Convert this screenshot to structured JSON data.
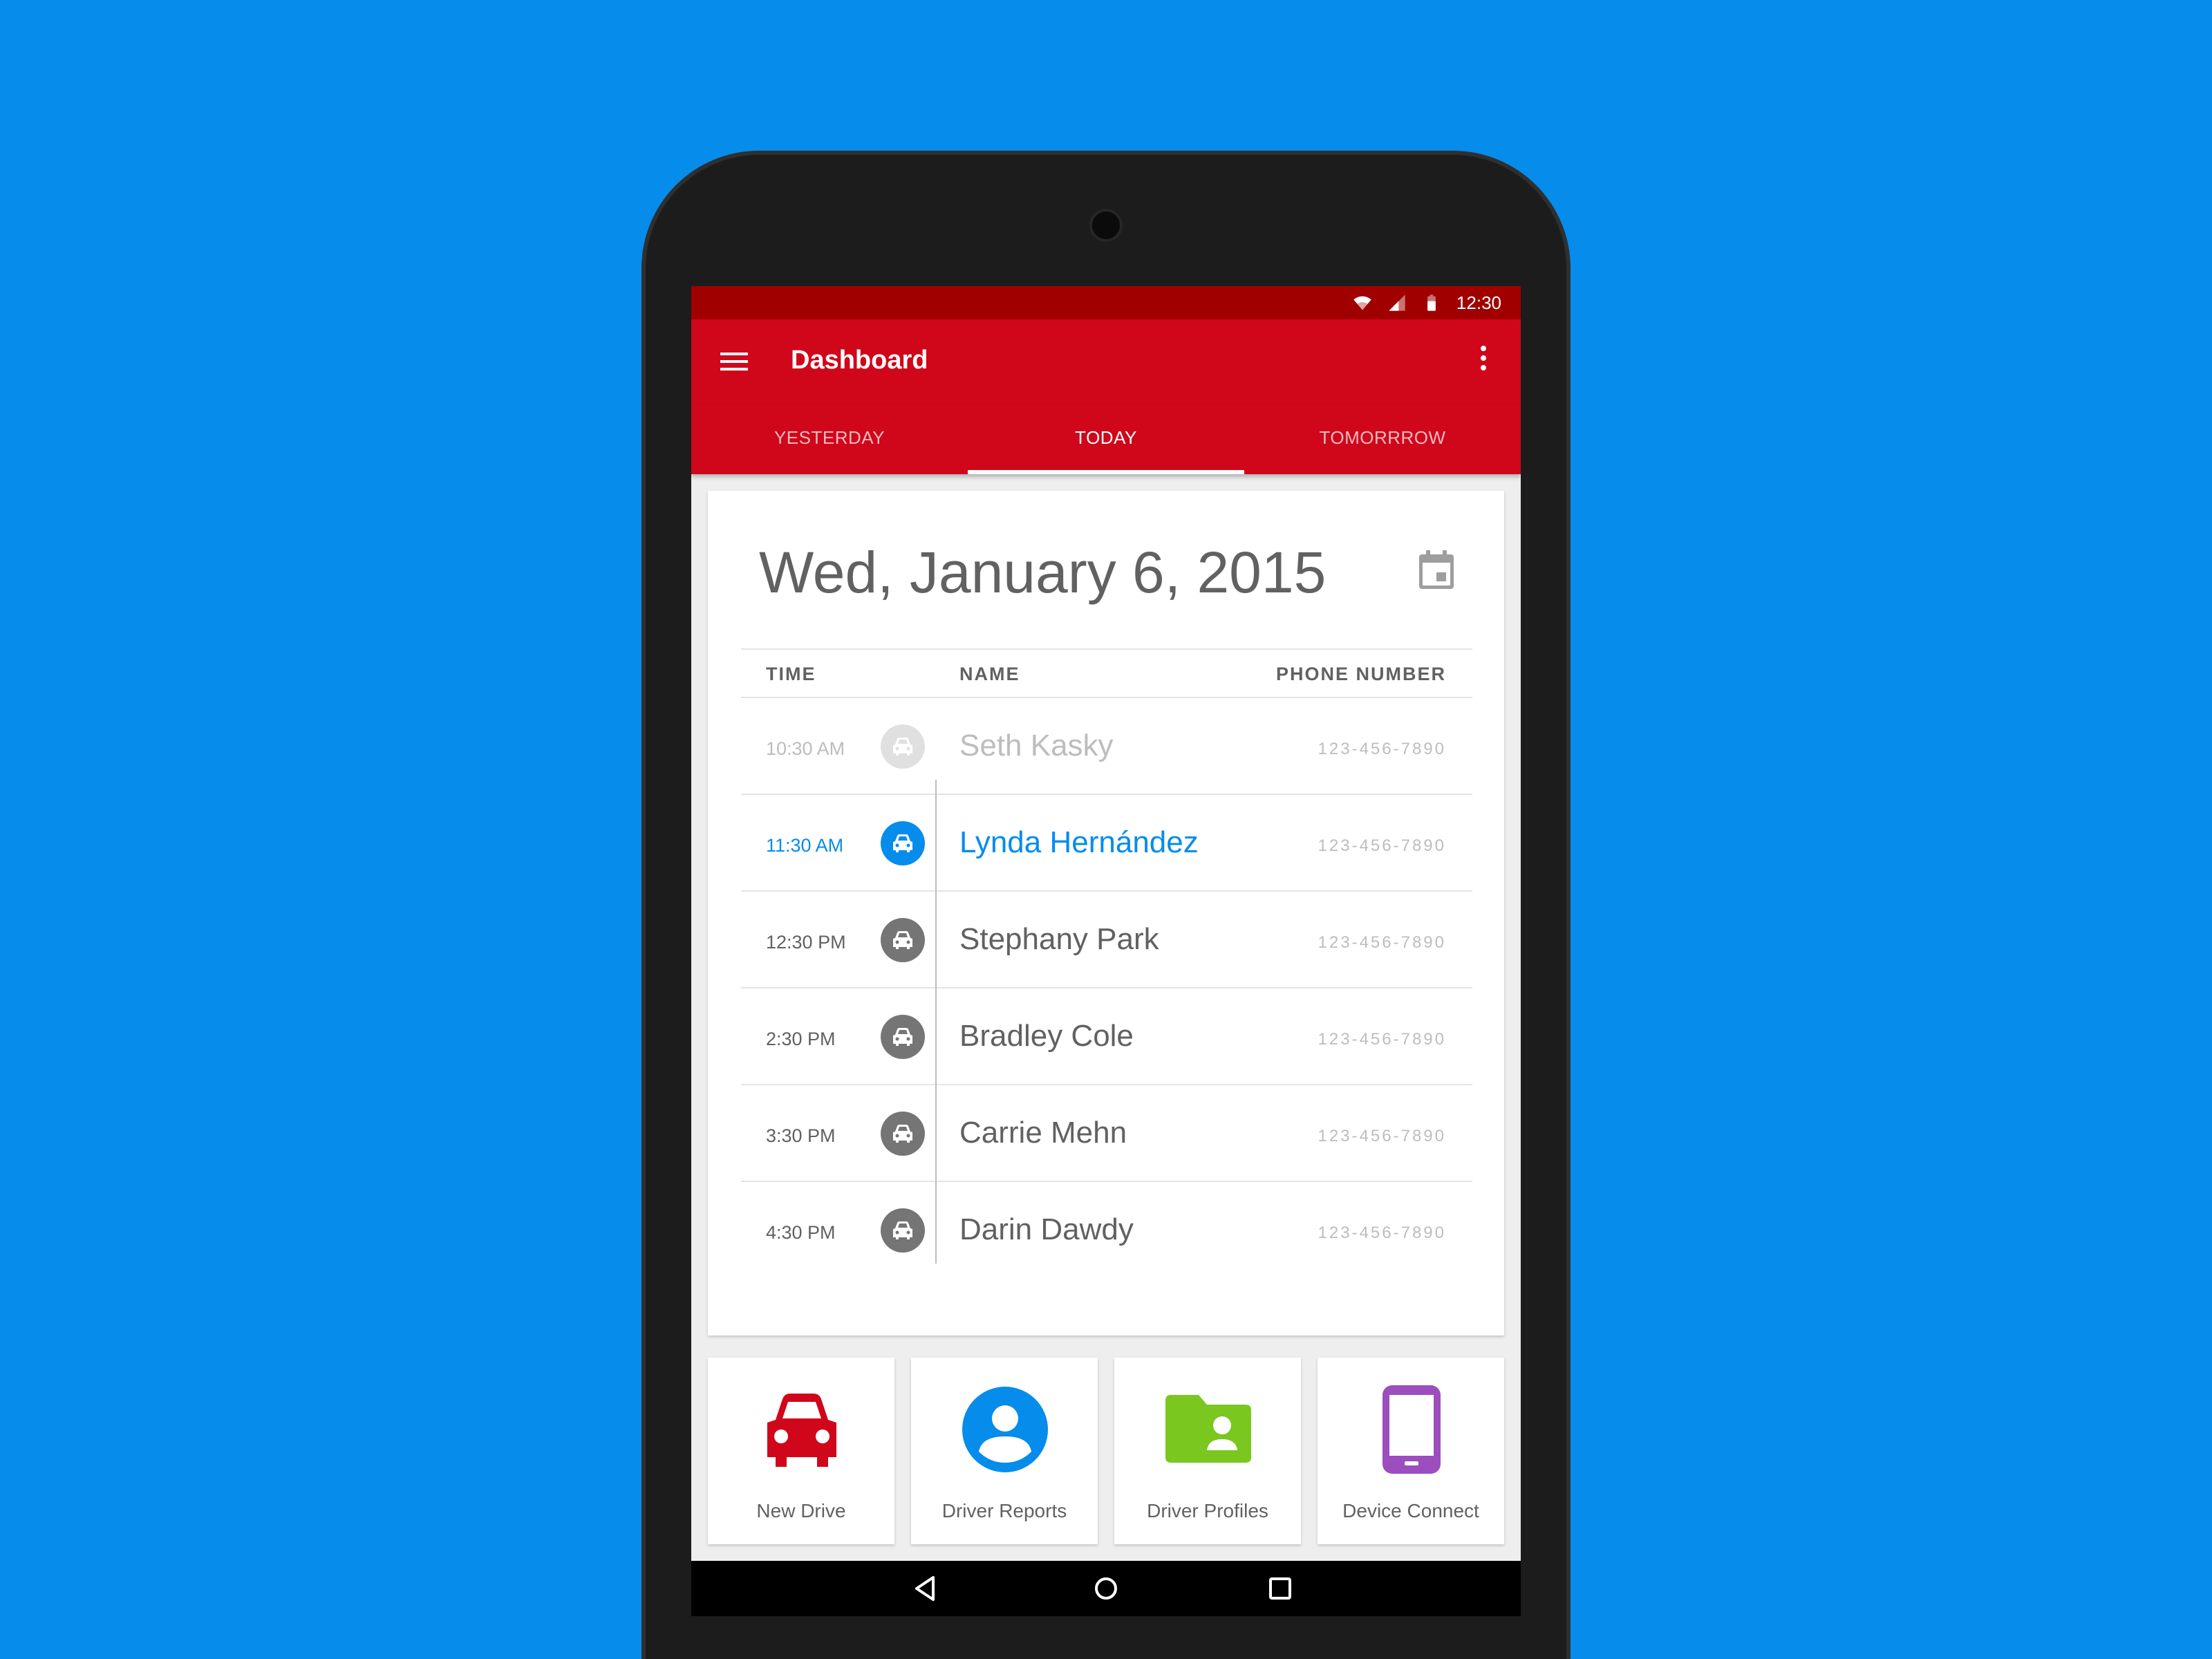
{
  "status_bar": {
    "time": "12:30"
  },
  "app_bar": {
    "title": "Dashboard"
  },
  "tabs": [
    {
      "label": "YESTERDAY",
      "active": false
    },
    {
      "label": "TODAY",
      "active": true
    },
    {
      "label": "TOMORRROW",
      "active": false
    }
  ],
  "schedule": {
    "date": "Wed, January 6, 2015",
    "headers": {
      "time": "TIME",
      "name": "NAME",
      "phone": "PHONE NUMBER"
    },
    "rows": [
      {
        "time": "10:30 AM",
        "name": "Seth Kasky",
        "phone": "123-456-7890",
        "state": "past"
      },
      {
        "time": "11:30 AM",
        "name": "Lynda Hernández",
        "phone": "123-456-7890",
        "state": "current"
      },
      {
        "time": "12:30 PM",
        "name": "Stephany Park",
        "phone": "123-456-7890",
        "state": "upcoming"
      },
      {
        "time": "2:30 PM",
        "name": "Bradley Cole",
        "phone": "123-456-7890",
        "state": "upcoming"
      },
      {
        "time": "3:30 PM",
        "name": "Carrie Mehn",
        "phone": "123-456-7890",
        "state": "upcoming"
      },
      {
        "time": "4:30 PM",
        "name": "Darin Dawdy",
        "phone": "123-456-7890",
        "state": "upcoming"
      }
    ]
  },
  "tiles": [
    {
      "label": "New Drive",
      "icon": "car-icon",
      "color": "#D0071A"
    },
    {
      "label": "Driver Reports",
      "icon": "account-circle-icon",
      "color": "#068CEB"
    },
    {
      "label": "Driver Profiles",
      "icon": "folder-user-icon",
      "color": "#7AC720"
    },
    {
      "label": "Device Connect",
      "icon": "phone-icon",
      "color": "#9C4DBE"
    }
  ],
  "colors": {
    "background": "#068CEB",
    "app_bar": "#D0071A",
    "status_bar": "#A00000",
    "accent": "#068CEB"
  }
}
